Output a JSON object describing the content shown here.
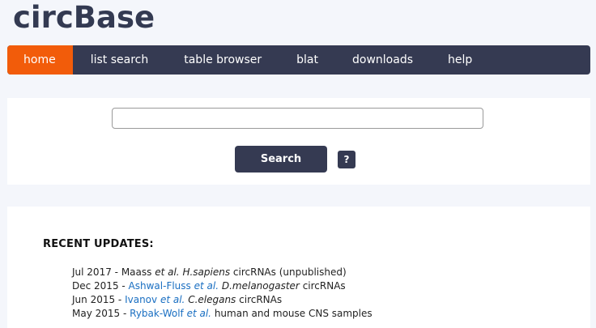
{
  "logo": "circBase",
  "nav": {
    "items": [
      {
        "label": "home",
        "active": true
      },
      {
        "label": "list search"
      },
      {
        "label": "table browser"
      },
      {
        "label": "blat"
      },
      {
        "label": "downloads"
      },
      {
        "label": "help"
      }
    ]
  },
  "search": {
    "input_value": "",
    "button_label": "Search",
    "help_label": "?"
  },
  "updates": {
    "heading": "RECENT UPDATES:",
    "items": [
      {
        "date": "Jul 2017",
        "sep": " - ",
        "author": "Maass",
        "etal": "et al.",
        "species": "H.sapiens",
        "rest": "circRNAs (unpublished)",
        "linked": false
      },
      {
        "date": "Dec 2015",
        "sep": " - ",
        "author": "Ashwal-Fluss",
        "etal": "et al.",
        "species": "D.melanogaster",
        "rest": "circRNAs",
        "linked": true
      },
      {
        "date": "Jun 2015",
        "sep": " - ",
        "author": "Ivanov",
        "etal": "et al.",
        "species": "C.elegans",
        "rest": "circRNAs",
        "linked": true
      },
      {
        "date": "May 2015",
        "sep": " - ",
        "author": "Rybak-Wolf",
        "etal": "et al.",
        "species": "",
        "rest": "human and mouse CNS samples",
        "linked": true
      }
    ]
  },
  "colors": {
    "nav_bg": "#353a52",
    "nav_active": "#f25c0a",
    "link": "#1a6fc2",
    "page_bg": "#f4f6fb"
  }
}
